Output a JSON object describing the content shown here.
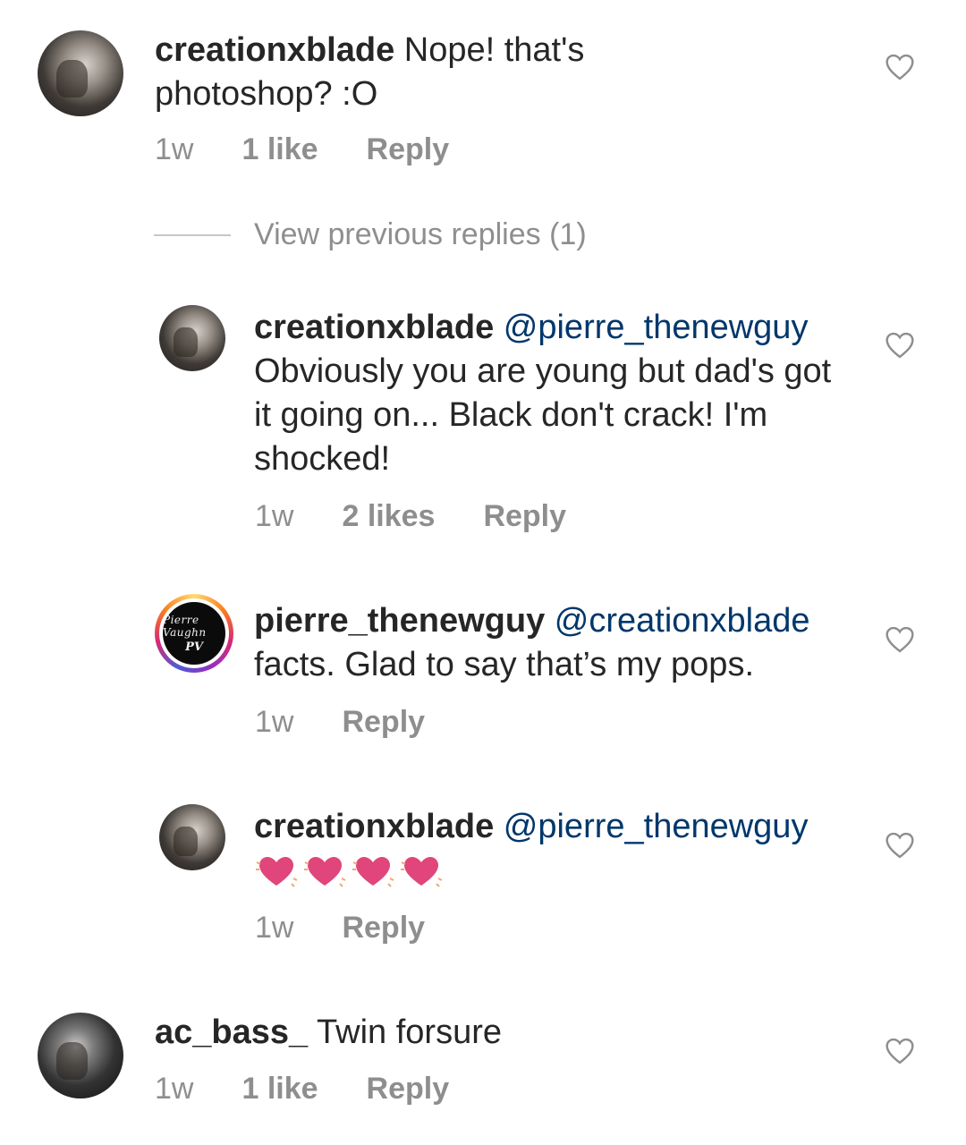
{
  "comments": [
    {
      "username": "creationxblade",
      "text": " Nope! that's photoshop? :O",
      "age": "1w",
      "likes": "1 like",
      "reply": "Reply"
    },
    {
      "username": "creationxblade",
      "mention": "@pierre_thenewguy",
      "text": "Obviously you are young but dad's got it going on... Black don't crack! I'm shocked!",
      "age": "1w",
      "likes": "2 likes",
      "reply": "Reply"
    },
    {
      "username": "pierre_thenewguy",
      "mention": "@creationxblade",
      "text": "facts. Glad to say that’s my pops.",
      "age": "1w",
      "reply": "Reply",
      "avatar_signature": "Pierre Vaughn",
      "avatar_monogram": "PV"
    },
    {
      "username": "creationxblade",
      "mention": "@pierre_thenewguy",
      "emoji": "💓💓💓💓",
      "age": "1w",
      "reply": "Reply"
    },
    {
      "username": "ac_bass_",
      "text": " Twin forsure",
      "age": "1w",
      "likes": "1 like",
      "reply": "Reply"
    }
  ],
  "view_previous_replies": "View previous replies (1)",
  "colors": {
    "text": "#262626",
    "meta": "#8e8e8e",
    "mention": "#00376b",
    "heart_emoji": "#e0457b"
  },
  "icons": {
    "like": "heart-outline-icon",
    "emoji": "beating-heart-emoji"
  }
}
